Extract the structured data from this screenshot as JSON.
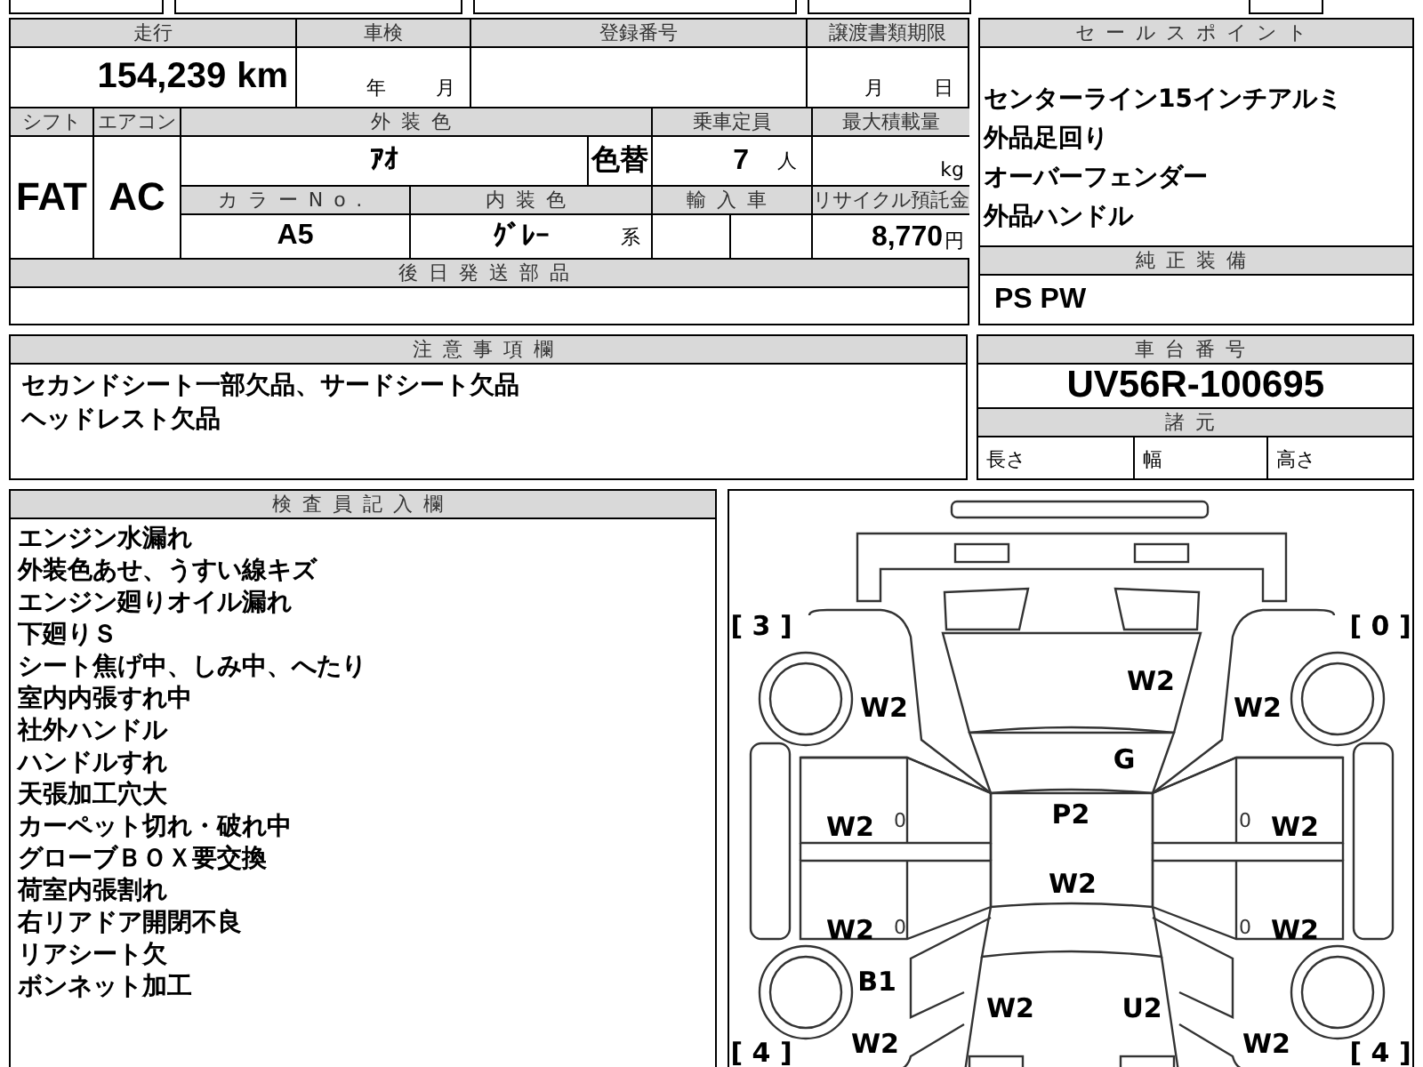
{
  "mileage": {
    "label": "走行",
    "value": "154,239",
    "unit": "km"
  },
  "inspection": {
    "label": "車検",
    "year_unit": "年",
    "month_unit": "月"
  },
  "registration_number": {
    "label": "登録番号"
  },
  "transfer_deadline": {
    "label": "譲渡書類期限",
    "month_unit": "月",
    "day_unit": "日"
  },
  "shift": {
    "label": "シフト",
    "value": "FAT"
  },
  "air_conditioner": {
    "label": "エアコン",
    "value": "AC"
  },
  "exterior_color": {
    "label": "外装色",
    "value": "ｱｵ",
    "color_change": "色替"
  },
  "capacity": {
    "label": "乗車定員",
    "value": "7",
    "unit": "人"
  },
  "max_load": {
    "label": "最大積載量",
    "unit": "kg"
  },
  "color_number": {
    "label": "カラーNo.",
    "value": "A5"
  },
  "interior_color": {
    "label": "内装色",
    "value": "ｸﾞﾚｰ",
    "suffix": "系"
  },
  "imported": {
    "label": "輸入車"
  },
  "recycle_deposit": {
    "label": "リサイクル預託金",
    "value": "8,770",
    "unit": "円"
  },
  "later_parts": {
    "label": "後日発送部品"
  },
  "sale_points": {
    "label": "セールスポイント",
    "items": [
      "センターライン15インチアルミ",
      "外品足回り",
      "オーバーフェンダー",
      "外品ハンドル"
    ]
  },
  "factory_equipment": {
    "label": "純正装備",
    "value": "PS PW"
  },
  "notes": {
    "label": "注意事項欄",
    "lines": [
      "セカンドシート一部欠品、サードシート欠品",
      "ヘッドレスト欠品"
    ]
  },
  "chassis_number": {
    "label": "車台番号",
    "value": "UV56R-100695"
  },
  "specs": {
    "label": "諸元",
    "items": [
      "長さ",
      "幅",
      "高さ"
    ]
  },
  "inspector_notes": {
    "label": "検査員記入欄",
    "lines": [
      "エンジン水漏れ",
      "外装色あせ、うすい線キズ",
      "エンジン廻りオイル漏れ",
      "下廻りＳ",
      "シート焦げ中、しみ中、へたり",
      "室内内張すれ中",
      "社外ハンドル",
      "ハンドルすれ",
      "天張加工穴大",
      "カーペット切れ・破れ中",
      "グローブＢＯＸ要交換",
      "荷室内張割れ",
      "右リアドア開閉不良",
      "リアシート欠",
      "ボンネット加工"
    ]
  },
  "damage_diagram": {
    "tire_marks": [
      "[ 3 ]",
      "[ 0 ]",
      "[ 4 ]",
      "[ 4 ]"
    ],
    "marks": [
      {
        "kind": "code",
        "code": "W2"
      },
      {
        "kind": "code",
        "code": "W2"
      },
      {
        "kind": "code",
        "code": "W2"
      },
      {
        "kind": "code",
        "code": "G"
      },
      {
        "kind": "code",
        "code": "P2"
      },
      {
        "kind": "code",
        "code": "W2"
      },
      {
        "kind": "note",
        "code": "0"
      },
      {
        "kind": "note",
        "code": "0"
      },
      {
        "kind": "code",
        "code": "W2"
      },
      {
        "kind": "code",
        "code": "W2"
      },
      {
        "kind": "code",
        "code": "W2"
      },
      {
        "kind": "note",
        "code": "0"
      },
      {
        "kind": "note",
        "code": "0"
      },
      {
        "kind": "code",
        "code": "W2"
      },
      {
        "kind": "code",
        "code": "B1"
      },
      {
        "kind": "code",
        "code": "W2"
      },
      {
        "kind": "code",
        "code": "U2"
      },
      {
        "kind": "code",
        "code": "W2"
      },
      {
        "kind": "code",
        "code": "W2"
      }
    ]
  }
}
